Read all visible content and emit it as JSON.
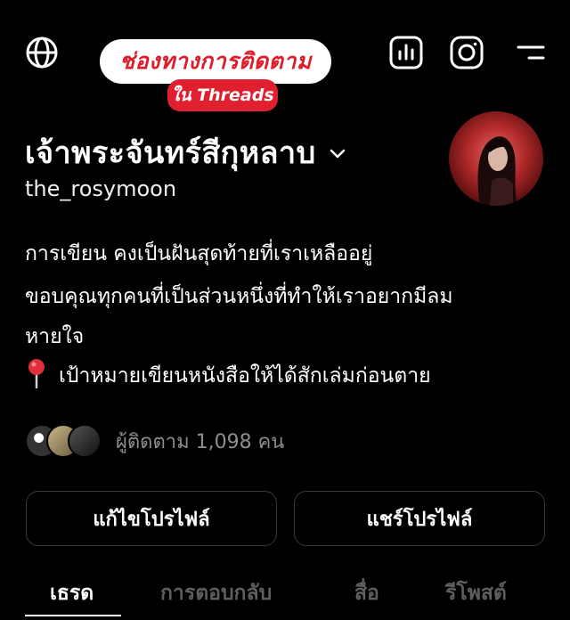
{
  "overlay": {
    "title": "ช่องทางการติดตาม",
    "subtitle": "ใน Threads"
  },
  "profile": {
    "name": "เจ้าพระจันทร์สีกุหลาบ",
    "handle": "the_rosymoon",
    "bio": [
      "การเขียน คงเป็นฝันสุดท้ายที่เราเหลืออยู่",
      "ขอบคุณทุกคนที่เป็นส่วนหนึ่งที่ทำให้เราอยากมีลม",
      "หายใจ",
      "เป้าหมายเขียนหนังสือให้ได้สักเล่มก่อนตาย"
    ],
    "followers": "ผู้ติดตาม 1,098 คน"
  },
  "buttons": {
    "edit": "แก้ไขโปรไฟล์",
    "share": "แชร์โปรไฟล์"
  },
  "tabs": [
    "เธรด",
    "การตอบกลับ",
    "สื่อ",
    "รีโพสต์"
  ],
  "icons": {
    "top_left": "globe-icon",
    "top_right": [
      "stats-icon",
      "instagram-icon",
      "menu-icon"
    ],
    "bio_marker": "pin-icon"
  },
  "colors": {
    "background": "#000000",
    "accent_red": "#e01b2a",
    "muted": "#8e8e8e"
  }
}
